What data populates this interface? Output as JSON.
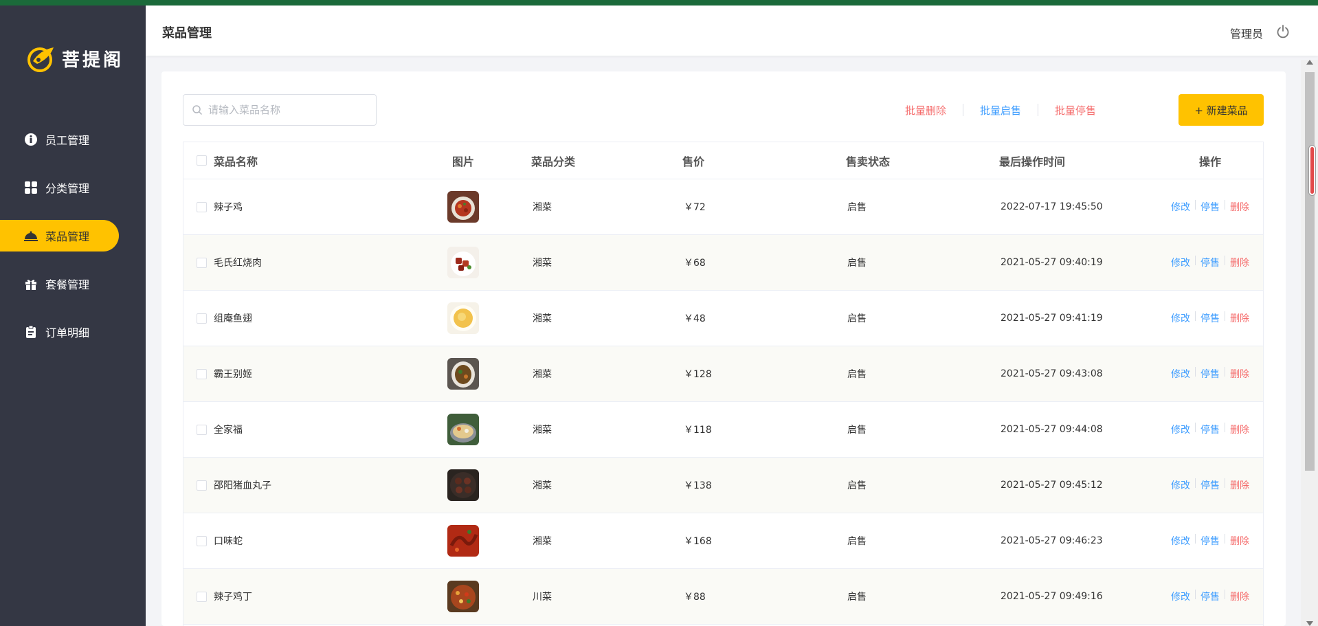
{
  "brand": {
    "name": "菩提阁",
    "accent": "#ffc200",
    "sidebar_bg": "#343744"
  },
  "sidebar": {
    "items": [
      {
        "label": "员工管理",
        "icon": "staff-icon",
        "active": false
      },
      {
        "label": "分类管理",
        "icon": "category-icon",
        "active": false
      },
      {
        "label": "菜品管理",
        "icon": "dish-icon",
        "active": true
      },
      {
        "label": "套餐管理",
        "icon": "gift-icon",
        "active": false
      },
      {
        "label": "订单明细",
        "icon": "clipboard-icon",
        "active": false
      }
    ]
  },
  "header": {
    "title": "菜品管理",
    "user": "管理员",
    "logout_icon": "power-icon"
  },
  "toolbar": {
    "search_placeholder": "请输入菜品名称",
    "batch_delete": "批量删除",
    "batch_enable": "批量启售",
    "batch_disable": "批量停售",
    "new_dish": "+ 新建菜品"
  },
  "table": {
    "columns": [
      "菜品名称",
      "图片",
      "菜品分类",
      "售价",
      "售卖状态",
      "最后操作时间",
      "操作"
    ],
    "ops": {
      "edit": "修改",
      "disable": "停售",
      "delete": "删除"
    },
    "rows": [
      {
        "name": "辣子鸡",
        "category": "湘菜",
        "price": "￥72",
        "status": "启售",
        "time": "2022-07-17 19:45:50"
      },
      {
        "name": "毛氏红烧肉",
        "category": "湘菜",
        "price": "￥68",
        "status": "启售",
        "time": "2021-05-27 09:40:19"
      },
      {
        "name": "组庵鱼翅",
        "category": "湘菜",
        "price": "￥48",
        "status": "启售",
        "time": "2021-05-27 09:41:19"
      },
      {
        "name": "霸王别姬",
        "category": "湘菜",
        "price": "￥128",
        "status": "启售",
        "time": "2021-05-27 09:43:08"
      },
      {
        "name": "全家福",
        "category": "湘菜",
        "price": "￥118",
        "status": "启售",
        "time": "2021-05-27 09:44:08"
      },
      {
        "name": "邵阳猪血丸子",
        "category": "湘菜",
        "price": "￥138",
        "status": "启售",
        "time": "2021-05-27 09:45:12"
      },
      {
        "name": "口味蛇",
        "category": "湘菜",
        "price": "￥168",
        "status": "启售",
        "time": "2021-05-27 09:46:23"
      },
      {
        "name": "辣子鸡丁",
        "category": "川菜",
        "price": "￥88",
        "status": "启售",
        "time": "2021-05-27 09:49:16"
      }
    ]
  }
}
